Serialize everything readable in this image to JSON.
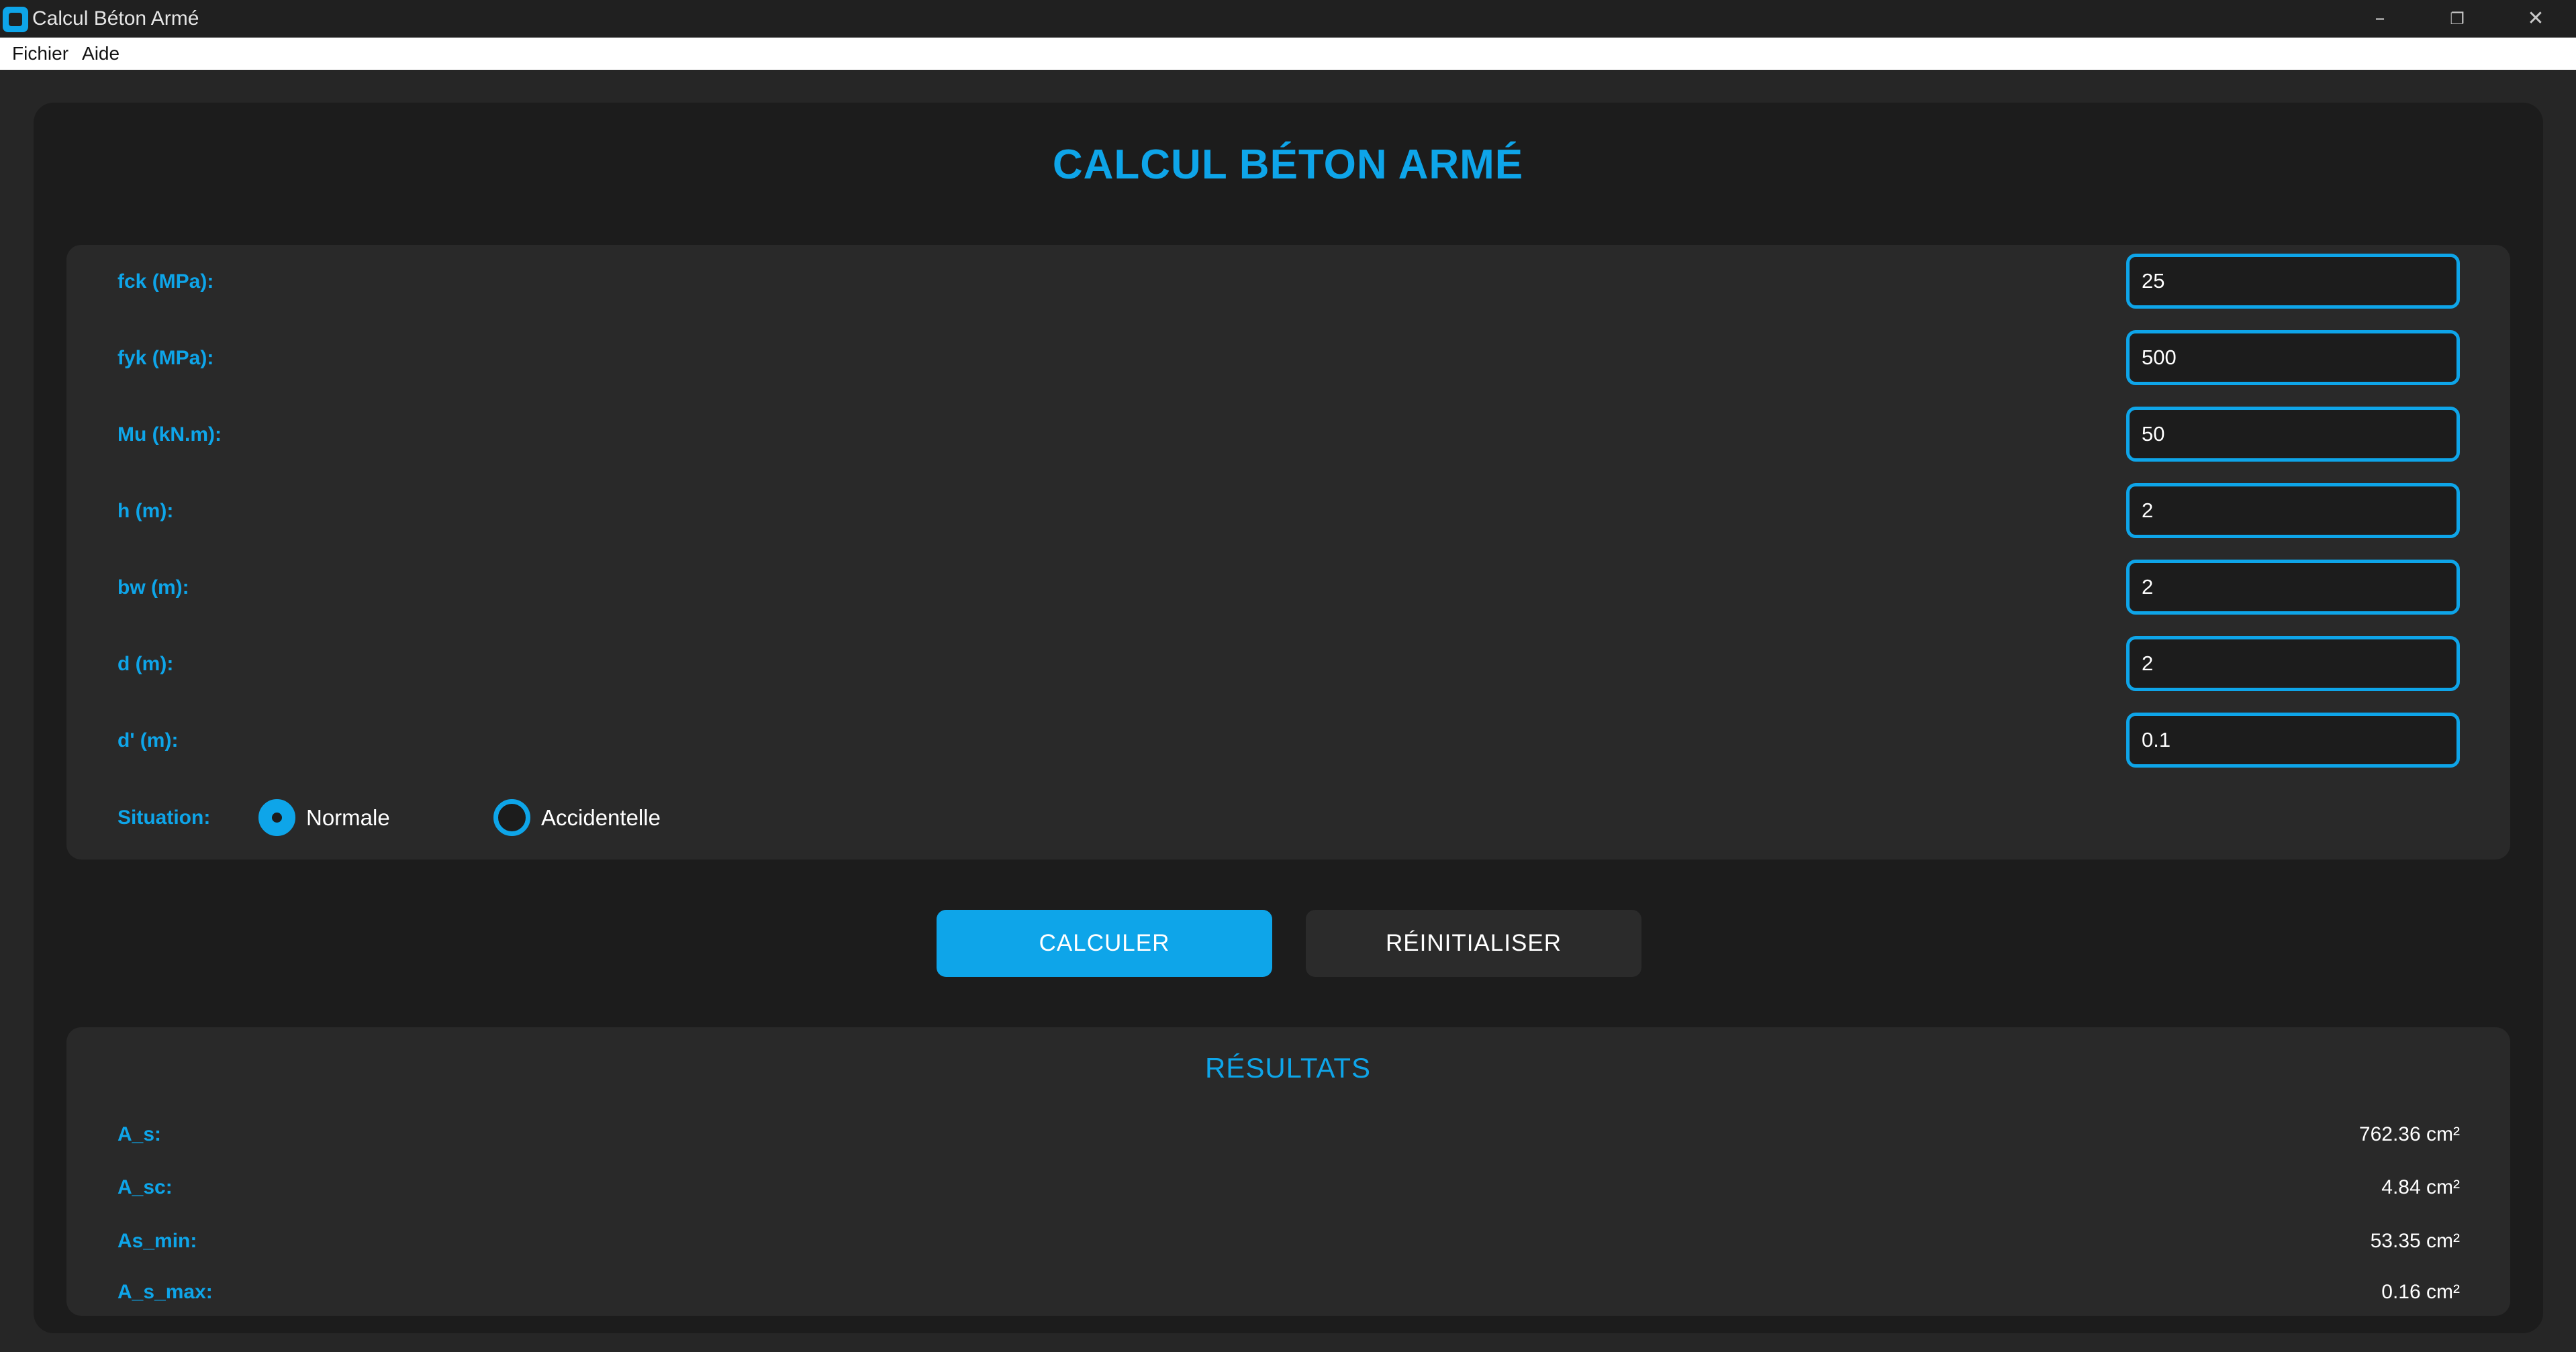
{
  "window": {
    "title": "Calcul Béton Armé",
    "controls": {
      "minimize": "–",
      "maximize": "❐",
      "close": "✕"
    }
  },
  "menu": {
    "items": [
      "Fichier",
      "Aide"
    ]
  },
  "header": {
    "title": "CALCUL BÉTON ARMÉ"
  },
  "inputs": [
    {
      "label": "fck (MPa):",
      "value": "25"
    },
    {
      "label": "fyk (MPa):",
      "value": "500"
    },
    {
      "label": "Mu (kN.m):",
      "value": "50"
    },
    {
      "label": "h (m):",
      "value": "2"
    },
    {
      "label": "bw (m):",
      "value": "2"
    },
    {
      "label": "d (m):",
      "value": "2"
    },
    {
      "label": "d' (m):",
      "value": "0.1"
    }
  ],
  "situation": {
    "label": "Situation:",
    "options": [
      {
        "label": "Normale",
        "selected": true
      },
      {
        "label": "Accidentelle",
        "selected": false
      }
    ]
  },
  "buttons": {
    "calculate": "CALCULER",
    "reset": "RÉINITIALISER"
  },
  "results": {
    "title": "RÉSULTATS",
    "rows": [
      {
        "label": "A_s:",
        "value": "762.36 cm²"
      },
      {
        "label": "A_sc:",
        "value": "4.84 cm²"
      },
      {
        "label": "As_min:",
        "value": "53.35 cm²"
      },
      {
        "label": "A_s_max:",
        "value": "0.16 cm²"
      }
    ]
  },
  "colors": {
    "accent": "#0ea5e9",
    "background": "#262626",
    "card": "#1c1c1c",
    "panel": "#292929"
  }
}
